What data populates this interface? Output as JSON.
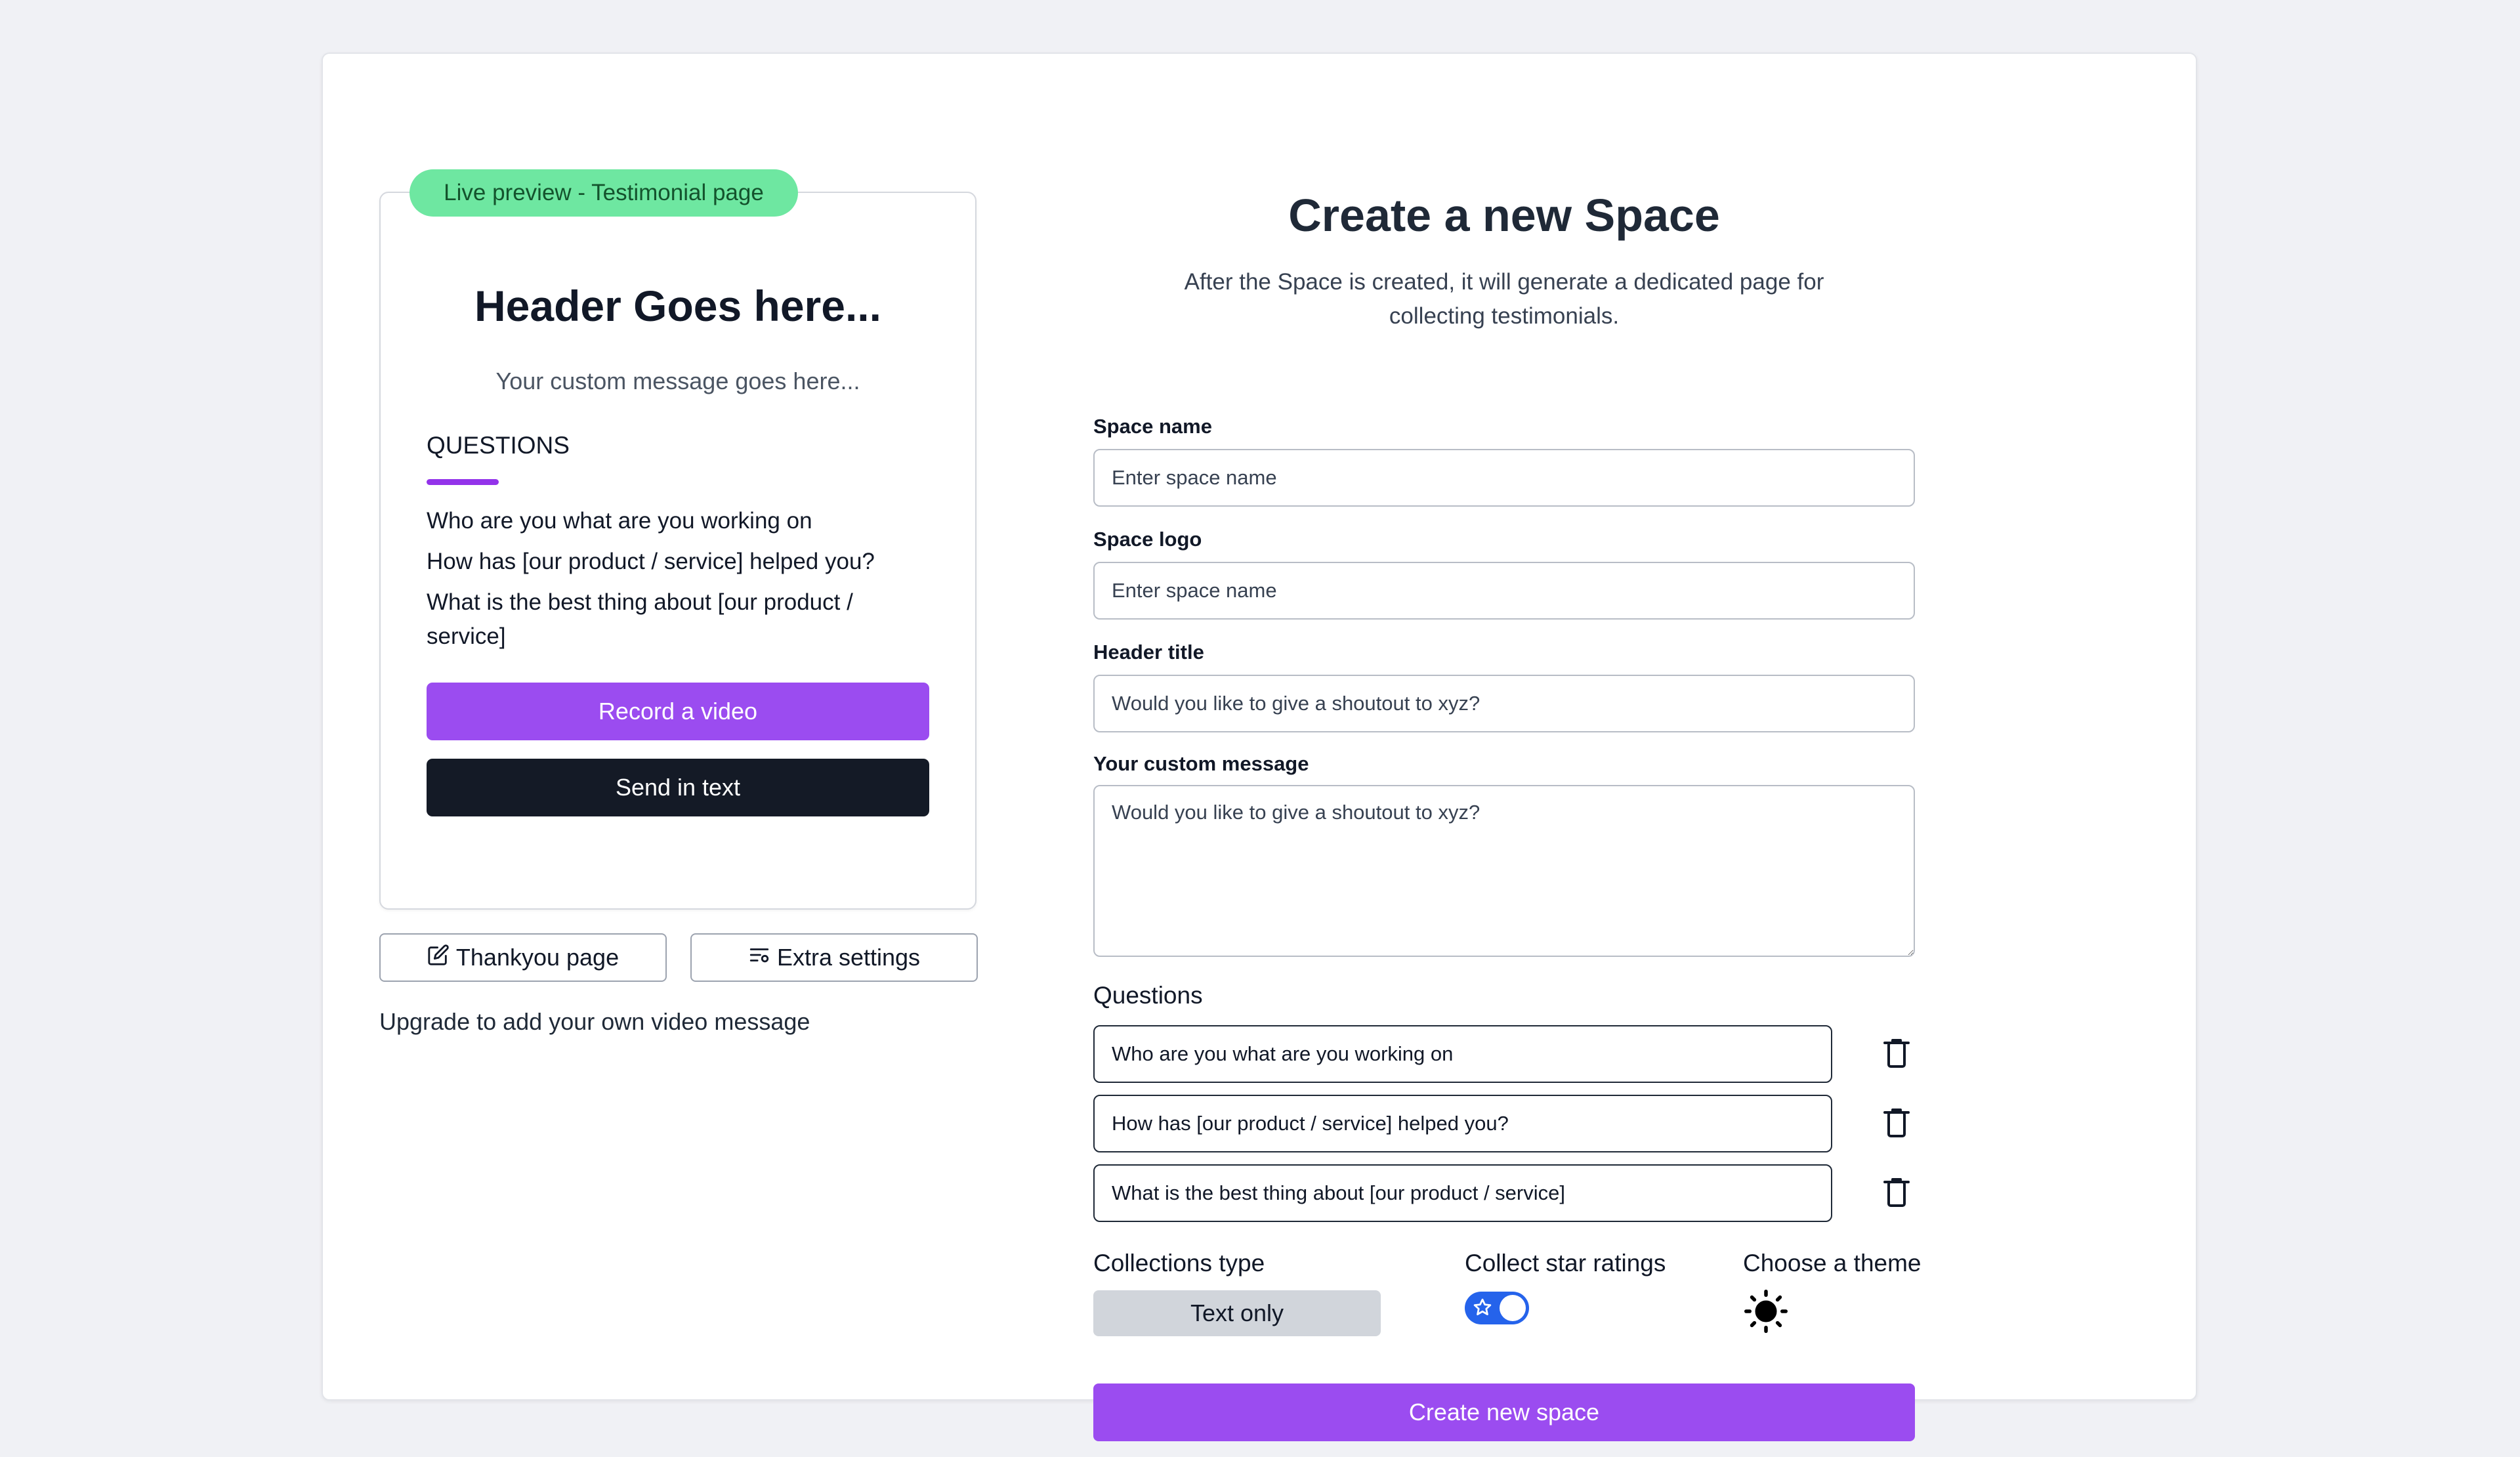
{
  "preview": {
    "badge": "Live preview - Testimonial page",
    "header": "Header Goes here...",
    "message": "Your custom message goes here...",
    "questions_title": "QUESTIONS",
    "questions": [
      "Who are you what are you working on",
      "How has [our product / service] helped you?",
      "What is the best thing about [our product / service]"
    ],
    "record_button": "Record a video",
    "text_button": "Send in text"
  },
  "actions": {
    "thankyou_label": "Thankyou page",
    "extra_label": "Extra settings",
    "upgrade_text": "Upgrade to add your own video message"
  },
  "form": {
    "title": "Create a new Space",
    "subtitle": "After the Space is created, it will generate a dedicated page for collecting testimonials.",
    "space_name": {
      "label": "Space name",
      "placeholder": "Enter space name"
    },
    "space_logo": {
      "label": "Space logo",
      "placeholder": "Enter space name"
    },
    "header_title": {
      "label": "Header title",
      "placeholder": "Would you like to give a shoutout to xyz?"
    },
    "custom_message": {
      "label": "Your custom message",
      "placeholder": "Would you like to give a shoutout to xyz?"
    },
    "questions_label": "Questions",
    "questions": [
      "Who are you what are you working on",
      "How has [our product / service] helped you?",
      "What is the best thing about [our product / service]"
    ],
    "collections_type": {
      "label": "Collections type",
      "value": "Text only"
    },
    "star_ratings": {
      "label": "Collect star ratings",
      "enabled": true
    },
    "theme": {
      "label": "Choose a theme",
      "icon": "sun-icon"
    },
    "submit_label": "Create new space"
  },
  "colors": {
    "accent": "#9b4cf0",
    "badge": "#6ee7a1",
    "dark_button": "#141a26",
    "toggle": "#2563eb"
  }
}
